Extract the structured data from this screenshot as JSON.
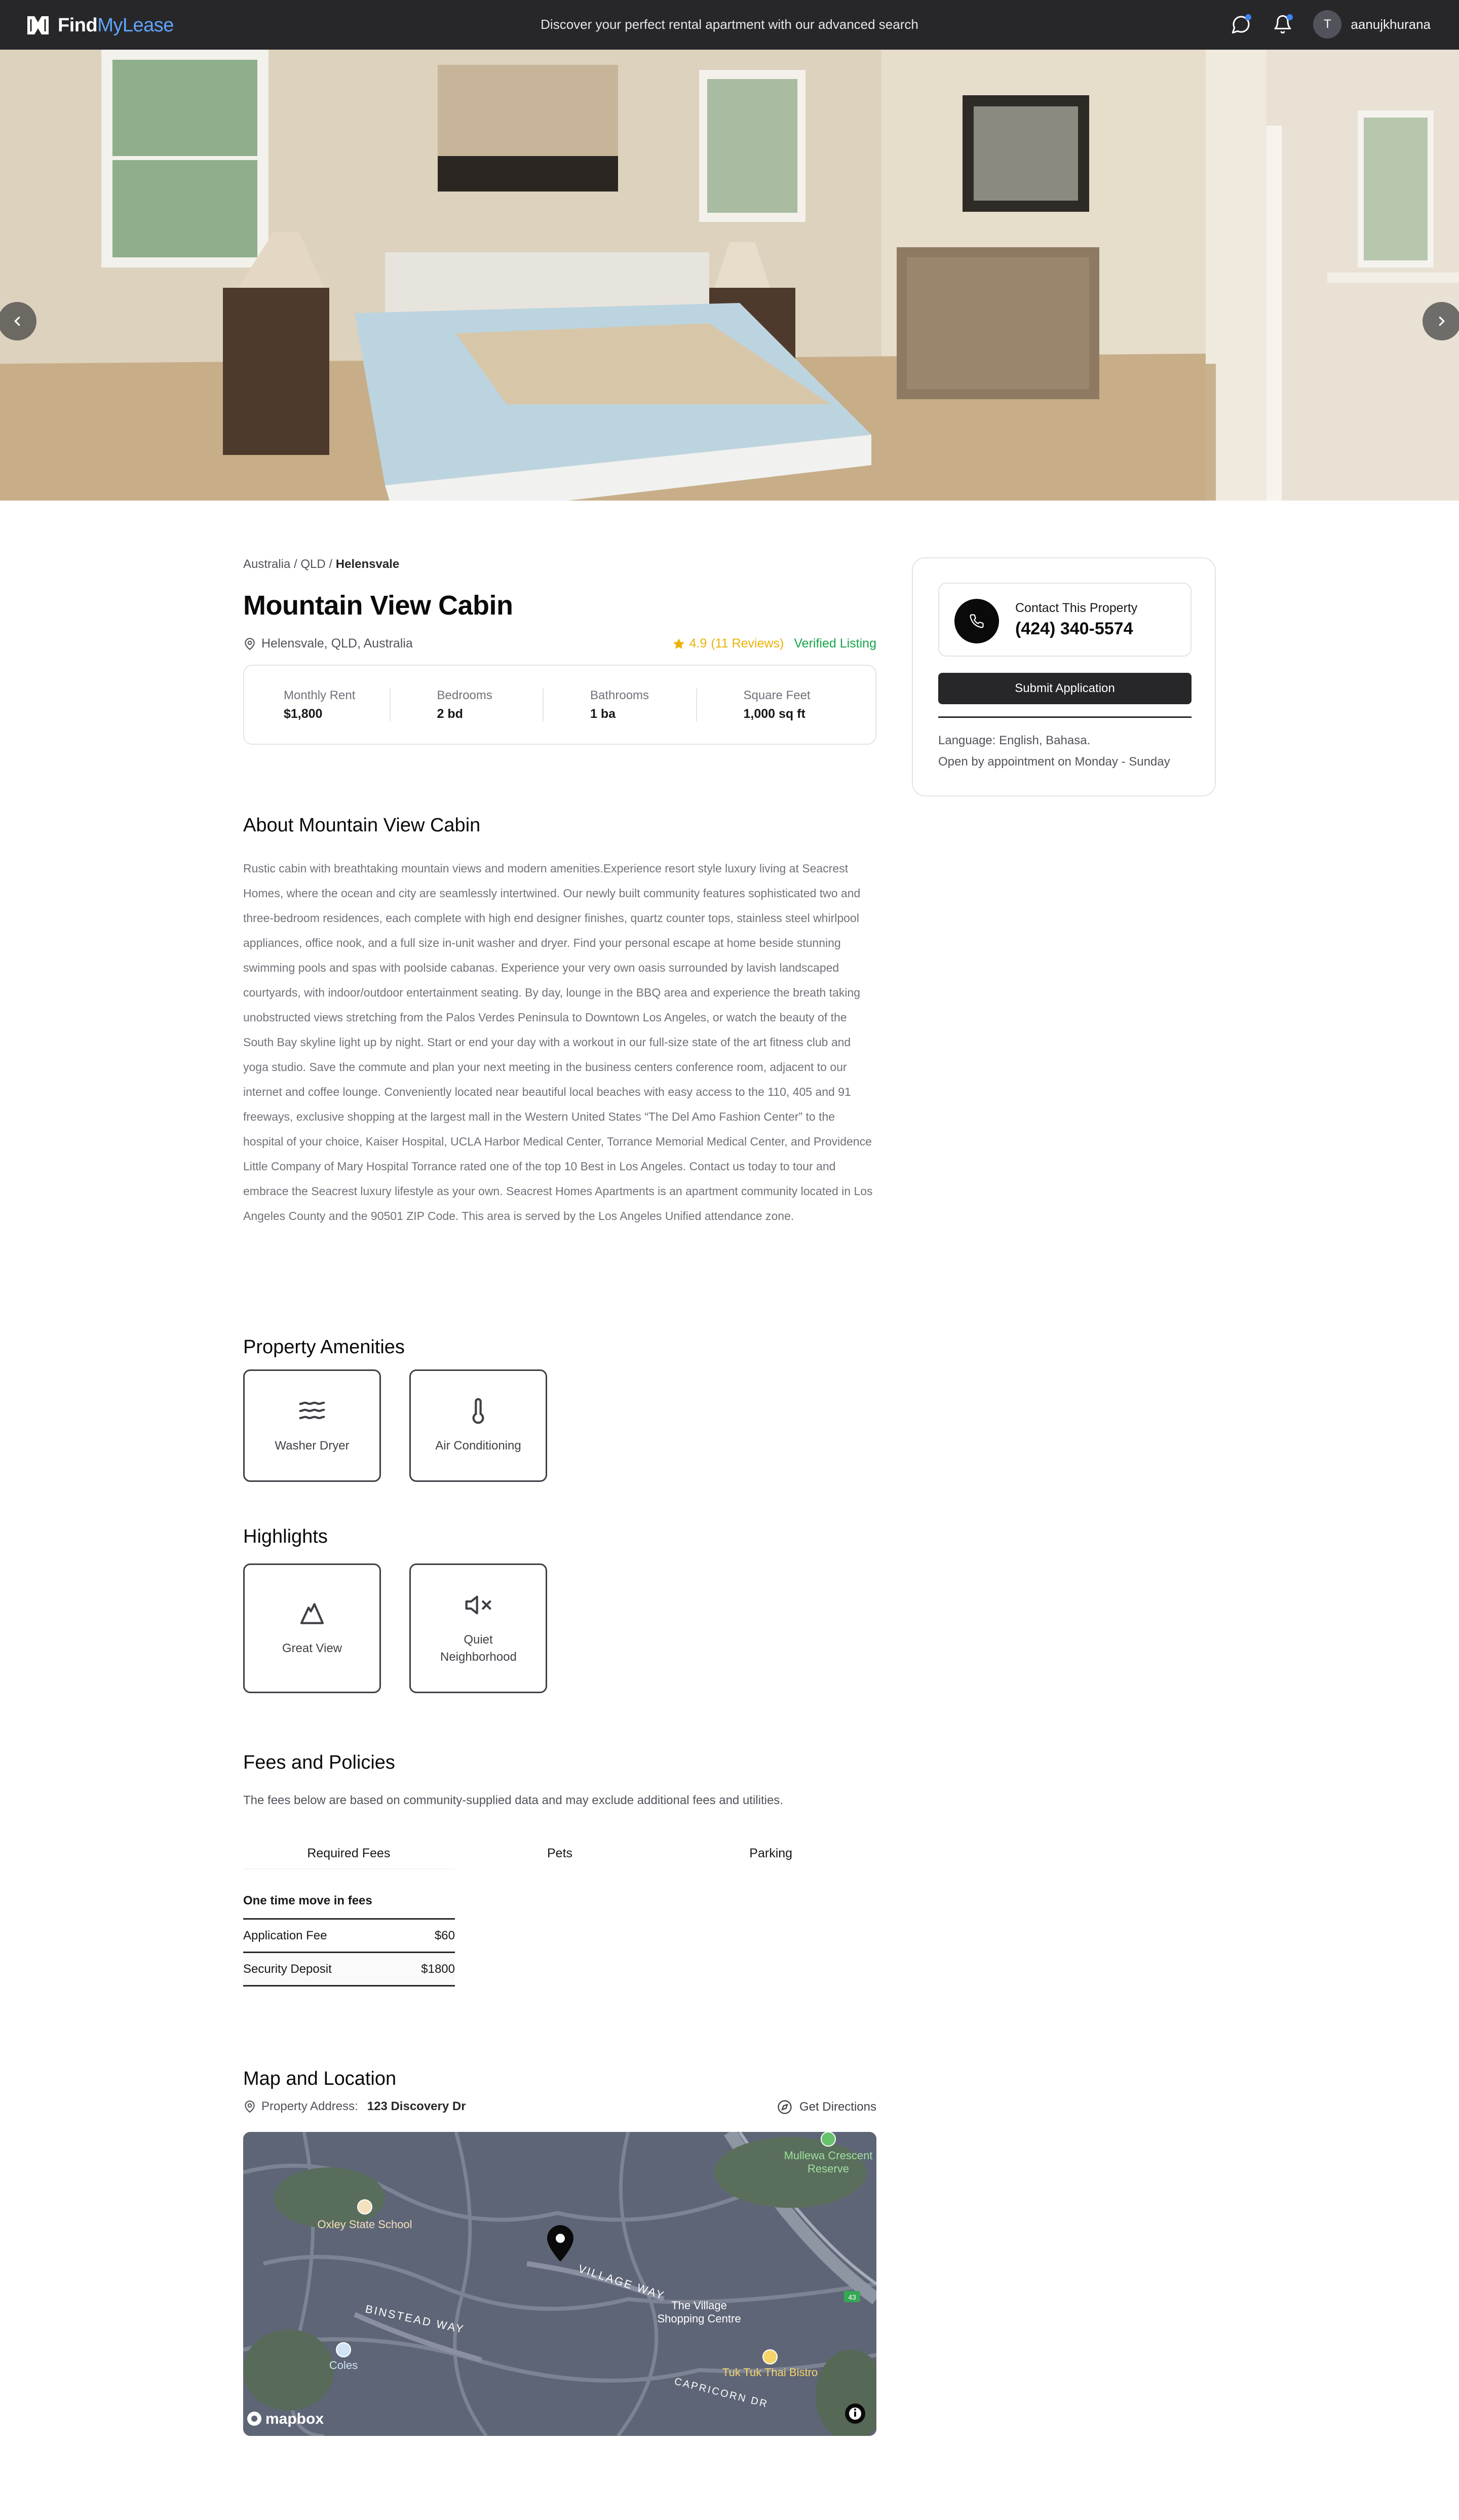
{
  "header": {
    "brand_bold": "Find",
    "brand_light": "MyLease",
    "tagline": "Discover your perfect rental apartment with our advanced search",
    "user_initial": "T",
    "username": "aanujkhurana"
  },
  "breadcrumb": {
    "country": "Australia",
    "state": "QLD",
    "suburb": "Helensvale",
    "sep": " / "
  },
  "property": {
    "title": "Mountain View Cabin",
    "location": "Helensvale, QLD, Australia",
    "rating": "4.9",
    "reviews": "(11 Reviews)",
    "verified": "Verified Listing"
  },
  "stats": [
    {
      "label": "Monthly Rent",
      "value": "$1,800"
    },
    {
      "label": "Bedrooms",
      "value": "2 bd"
    },
    {
      "label": "Bathrooms",
      "value": "1 ba"
    },
    {
      "label": "Square Feet",
      "value": "1,000 sq ft"
    }
  ],
  "about": {
    "heading": "About Mountain View Cabin",
    "text": "Rustic cabin with breathtaking mountain views and modern amenities.Experience resort style luxury living at Seacrest Homes, where the ocean and city are seamlessly intertwined. Our newly built community features sophisticated two and three-bedroom residences, each complete with high end designer finishes, quartz counter tops, stainless steel whirlpool appliances, office nook, and a full size in-unit washer and dryer. Find your personal escape at home beside stunning swimming pools and spas with poolside cabanas. Experience your very own oasis surrounded by lavish landscaped courtyards, with indoor/outdoor entertainment seating. By day, lounge in the BBQ area and experience the breath taking unobstructed views stretching from the Palos Verdes Peninsula to Downtown Los Angeles, or watch the beauty of the South Bay skyline light up by night. Start or end your day with a workout in our full-size state of the art fitness club and yoga studio. Save the commute and plan your next meeting in the business centers conference room, adjacent to our internet and coffee lounge. Conveniently located near beautiful local beaches with easy access to the 110, 405 and 91 freeways, exclusive shopping at the largest mall in the Western United States “The Del Amo Fashion Center” to the hospital of your choice, Kaiser Hospital, UCLA Harbor Medical Center, Torrance Memorial Medical Center, and Providence Little Company of Mary Hospital Torrance rated one of the top 10 Best in Los Angeles. Contact us today to tour and embrace the Seacrest luxury lifestyle as your own. Seacrest Homes Apartments is an apartment community located in Los Angeles County and the 90501 ZIP Code. This area is served by the Los Angeles Unified attendance zone."
  },
  "amenities": {
    "heading": "Property Amenities",
    "items": [
      {
        "label": "Washer Dryer",
        "icon": "waves-icon"
      },
      {
        "label": "Air Conditioning",
        "icon": "thermometer-icon"
      }
    ]
  },
  "highlights": {
    "heading": "Highlights",
    "items": [
      {
        "label": "Great View",
        "icon": "mountain-icon"
      },
      {
        "label": "Quiet Neighborhood",
        "icon": "volume-mute-icon"
      }
    ]
  },
  "fees": {
    "heading": "Fees and Policies",
    "description": "The fees below are based on community-supplied data and may exclude additional fees and utilities.",
    "tabs": [
      "Required Fees",
      "Pets",
      "Parking"
    ],
    "subheading": "One time move in fees",
    "rows": [
      {
        "label": "Application Fee",
        "value": "$60"
      },
      {
        "label": "Security Deposit",
        "value": "$1800"
      }
    ]
  },
  "map": {
    "heading": "Map and Location",
    "address_label": "Property Address:",
    "address": "123 Discovery Dr",
    "directions": "Get Directions",
    "labels": {
      "school": "Oxley State School",
      "reserve_1": "Mullewa Crescent",
      "reserve_2": "Reserve",
      "street_1": "VILLAGE WAY",
      "street_2": "BINSTEAD WAY",
      "street_3": "CAPRICORN DR",
      "centre_1": "The Village",
      "centre_2": "Shopping Centre",
      "store": "Coles",
      "restaurant": "Tuk Tuk Thai Bistro",
      "road_badge": "43",
      "attribution": "mapbox"
    }
  },
  "contact": {
    "label": "Contact This Property",
    "phone": "(424) 340-5574",
    "submit": "Submit Application",
    "language": "Language: English, Bahasa.",
    "hours": "Open by appointment on Monday - Sunday"
  },
  "colors": {
    "nav_bg": "#27272a",
    "brand_accent": "#60a5fa",
    "rating": "#eab308",
    "verified": "#16a34a",
    "button": "#27272a",
    "map_bg": "#5c6475"
  }
}
